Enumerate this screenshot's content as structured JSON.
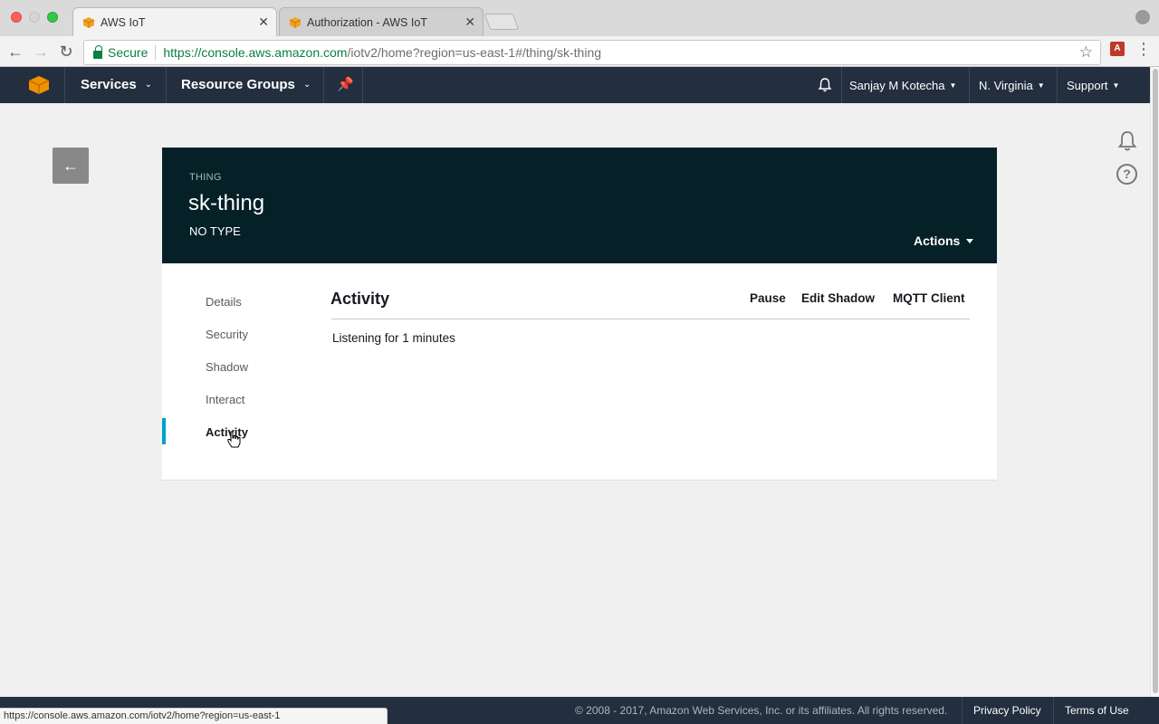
{
  "browser": {
    "tabs": [
      {
        "title": "AWS IoT",
        "active": true
      },
      {
        "title": "Authorization - AWS IoT",
        "active": false
      }
    ],
    "secure_label": "Secure",
    "url_scheme_host": "https://console.aws.amazon.com",
    "url_path": "/iotv2/home?region=us-east-1#/thing/sk-thing",
    "status_url": "https://console.aws.amazon.com/iotv2/home?region=us-east-1"
  },
  "aws_nav": {
    "services": "Services",
    "resource_groups": "Resource Groups",
    "user": "Sanjay M Kotecha",
    "region": "N. Virginia",
    "support": "Support"
  },
  "thing": {
    "kind_label": "THING",
    "name": "sk-thing",
    "type": "NO TYPE",
    "actions_label": "Actions"
  },
  "side_nav": {
    "items": [
      "Details",
      "Security",
      "Shadow",
      "Interact",
      "Activity"
    ],
    "active": "Activity"
  },
  "content": {
    "title": "Activity",
    "pause": "Pause",
    "edit_shadow": "Edit Shadow",
    "mqtt_client": "MQTT Client",
    "listening_text": "Listening for 1 minutes"
  },
  "footer": {
    "copyright": "© 2008 - 2017, Amazon Web Services, Inc. or its affiliates. All rights reserved.",
    "privacy": "Privacy Policy",
    "terms": "Terms of Use"
  },
  "colors": {
    "aws_nav_bg": "#232f3e",
    "thing_header_bg": "#062028",
    "active_indicator": "#00a1c9",
    "secure_green": "#0b8043"
  }
}
